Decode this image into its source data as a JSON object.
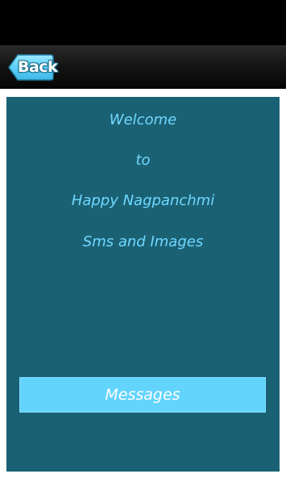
{
  "toolbar": {
    "back_label": "Back"
  },
  "welcome": {
    "line1": "Welcome",
    "line2": "to",
    "line3": "Happy Nagpanchmi",
    "line4": "Sms and Images"
  },
  "actions": {
    "messages_label": "Messages"
  },
  "colors": {
    "panel": "#1b6174",
    "accent": "#63d4fd",
    "text": "#6fd8ff"
  }
}
